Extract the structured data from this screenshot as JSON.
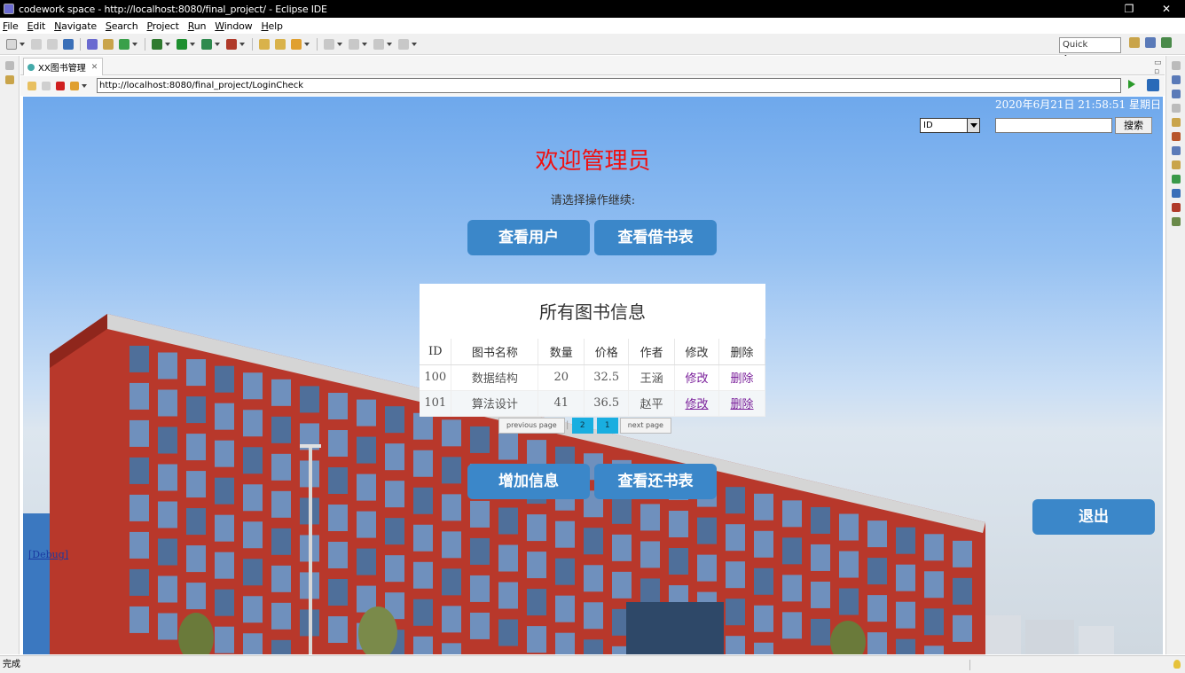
{
  "window": {
    "title": "codework space - http://localhost:8080/final_project/ - Eclipse IDE",
    "restore_glyph": "❐",
    "close_glyph": "✕"
  },
  "menu": [
    "File",
    "Edit",
    "Navigate",
    "Search",
    "Project",
    "Run",
    "Window",
    "Help"
  ],
  "toolbar": {
    "quick_access": "Quick Access"
  },
  "editor_tab": {
    "label": "XX图书管理",
    "close": "✕"
  },
  "browser": {
    "url": "http://localhost:8080/final_project/LoginCheck"
  },
  "page": {
    "datetime": "2020年6月21日 21:58:51 星期日",
    "search": {
      "selected_option": "ID",
      "value": "",
      "button": "搜索"
    },
    "welcome": "欢迎管理员",
    "prompt": "请选择操作继续:",
    "buttons": {
      "view_users": "查看用户",
      "view_borrow": "查看借书表",
      "add_info": "增加信息",
      "view_return": "查看还书表",
      "exit": "退出"
    },
    "books": {
      "title": "所有图书信息",
      "columns": [
        "ID",
        "图书名称",
        "数量",
        "价格",
        "作者",
        "修改",
        "删除"
      ],
      "rows": [
        [
          "100",
          "数据结构",
          "20",
          "32.5",
          "王涵",
          "修改",
          "删除"
        ],
        [
          "101",
          "算法设计",
          "41",
          "36.5",
          "赵平",
          "修改",
          "删除"
        ]
      ]
    },
    "pager": {
      "prev": "previous page",
      "sep": "|",
      "pages": [
        "2",
        "1"
      ],
      "next": "next page"
    },
    "debug": "[Debug]"
  },
  "status": {
    "text": "完成"
  },
  "colors": {
    "button": "#3b87c9",
    "welcome": "#f01010",
    "pager_num": "#19aee0",
    "building": "#b8382b"
  }
}
